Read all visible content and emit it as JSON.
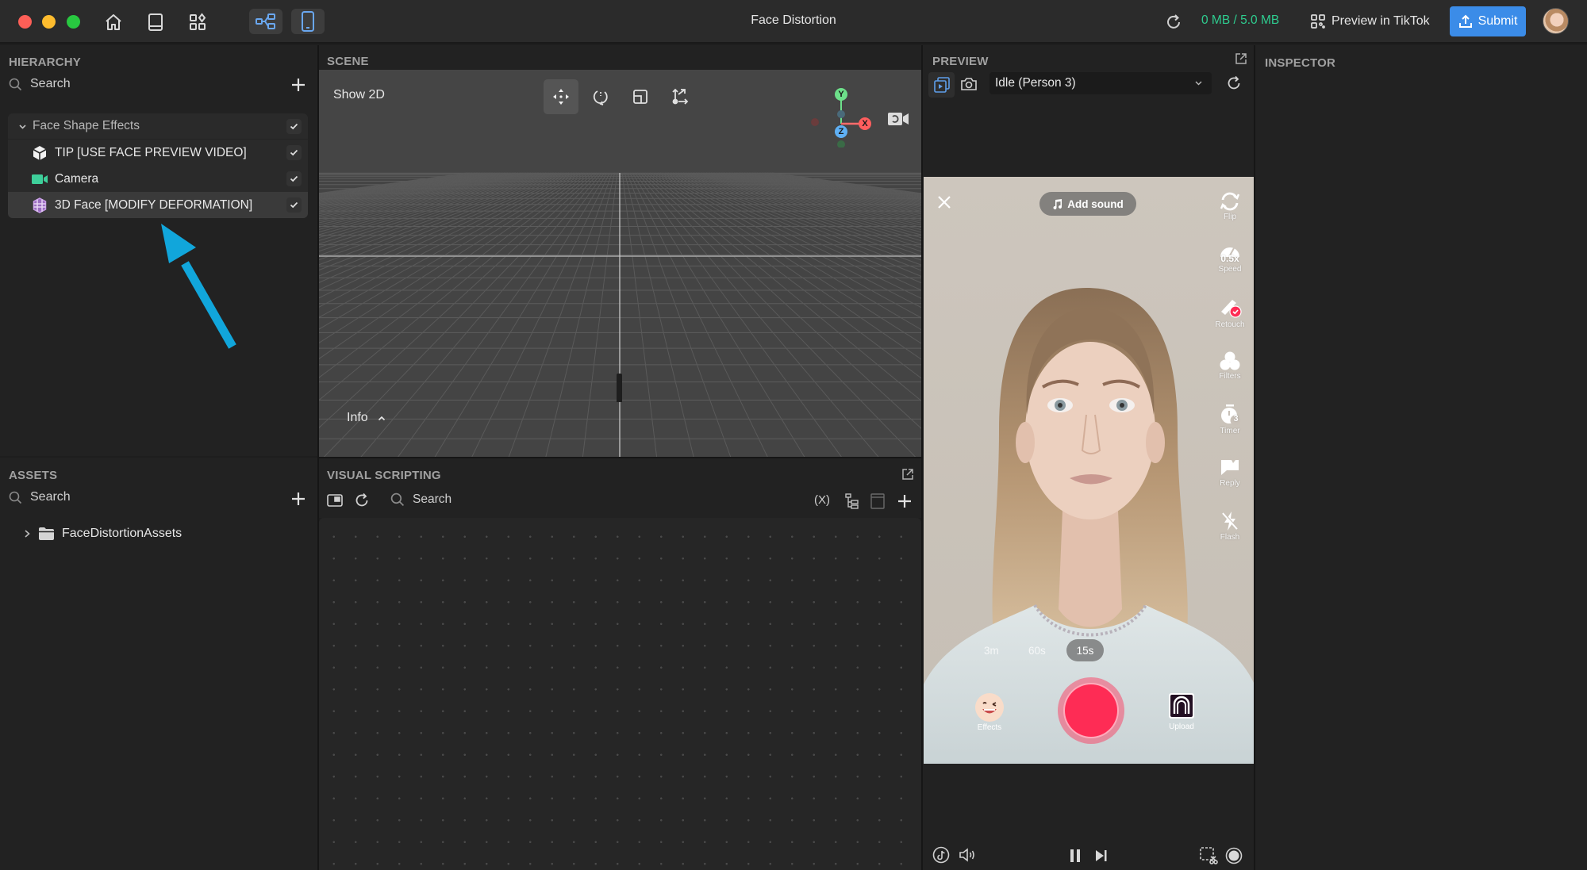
{
  "window": {
    "title": "Face Distortion",
    "traffic_lights": {
      "close": "#fe5f57",
      "minimize": "#febc2e",
      "zoom": "#28c840"
    }
  },
  "toolbar": {
    "left_icons": [
      "home-icon",
      "book-icon",
      "apps-icon"
    ],
    "toggles": [
      {
        "icon": "node-graph-icon",
        "active": true
      },
      {
        "icon": "phone-icon",
        "active": true
      }
    ],
    "memory_usage": "0 MB / 5.0 MB",
    "memory_color": "#2ecc8f",
    "preview_in_tiktok": "Preview in TikTok",
    "submit": "Submit",
    "accent": "#3b8ce8"
  },
  "hierarchy": {
    "title": "HIERARCHY",
    "search_placeholder": "Search",
    "items": [
      {
        "label": "Face Shape Effects",
        "icon": "chevron-down-icon",
        "checked": true,
        "level": 0
      },
      {
        "label": "TIP [USE FACE PREVIEW VIDEO]",
        "icon": "cube-icon",
        "checked": true,
        "level": 1
      },
      {
        "label": "Camera",
        "icon": "camera-icon",
        "checked": true,
        "level": 1
      },
      {
        "label": "3D Face [MODIFY DEFORMATION]",
        "icon": "face-mesh-icon",
        "checked": true,
        "level": 1,
        "selected": true
      }
    ],
    "annotation_arrow_color": "#11a6db"
  },
  "assets": {
    "title": "ASSETS",
    "search_placeholder": "Search",
    "items": [
      {
        "label": "FaceDistortionAssets",
        "icon": "folder-icon",
        "expanded": false
      }
    ]
  },
  "scene": {
    "title": "SCENE",
    "show_2d": "Show 2D",
    "tools": [
      "move-tool",
      "rotate-tool",
      "scale-tool",
      "transform-tool"
    ],
    "active_tool": "move-tool",
    "gizmo": {
      "y": "Y",
      "x": "X",
      "z": "Z"
    },
    "info": "Info"
  },
  "visual_scripting": {
    "title": "VISUAL SCRIPTING",
    "search_placeholder": "Search",
    "variables_label": "(X)"
  },
  "preview": {
    "title": "PREVIEW",
    "preset": "Idle (Person 3)",
    "phone": {
      "add_sound": "Add sound",
      "side_buttons": [
        {
          "label": "Flip",
          "icon": "flip-icon"
        },
        {
          "label": "Speed",
          "icon": "speed-icon",
          "value": "0.5x"
        },
        {
          "label": "Retouch",
          "icon": "retouch-icon"
        },
        {
          "label": "Filters",
          "icon": "filters-icon"
        },
        {
          "label": "Timer",
          "icon": "timer-icon",
          "value": "3"
        },
        {
          "label": "Reply",
          "icon": "reply-icon"
        },
        {
          "label": "Flash",
          "icon": "flash-off-icon"
        }
      ],
      "durations": [
        {
          "label": "3m",
          "selected": false
        },
        {
          "label": "60s",
          "selected": false
        },
        {
          "label": "15s",
          "selected": true
        }
      ],
      "effects": "Effects",
      "upload": "Upload",
      "record_color": "#fe2c55"
    }
  },
  "inspector": {
    "title": "INSPECTOR"
  }
}
